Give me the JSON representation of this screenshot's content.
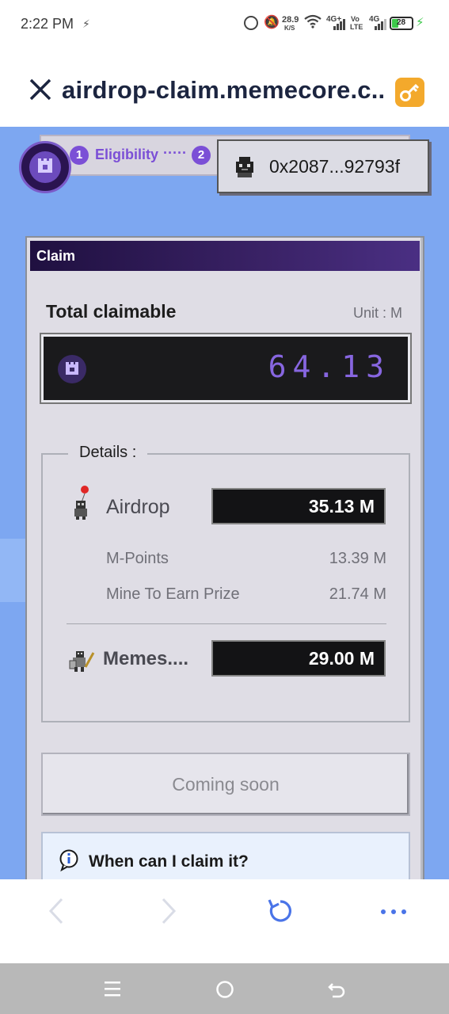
{
  "status": {
    "time": "2:22 PM",
    "speed_value": "28.9",
    "speed_unit": "K/S",
    "net1": "4G+",
    "volte_top": "Vo",
    "volte_bottom": "LTE",
    "net2": "4G",
    "battery": "28"
  },
  "browser": {
    "url": "airdrop-claim.memecore.c.."
  },
  "steps": {
    "step1_num": "1",
    "step1_label": "Eligibility",
    "dots": "·····",
    "step2_num": "2"
  },
  "wallet": {
    "address": "0x2087...92793f"
  },
  "claim": {
    "title": "Claim",
    "total_label": "Total claimable",
    "unit_label": "Unit : M",
    "total_value": "64.13",
    "details_legend": "Details :",
    "airdrop_label": "Airdrop",
    "airdrop_value": "35.13  M",
    "mpoints_label": "M-Points",
    "mpoints_value": "13.39 M",
    "mine_label": "Mine To Earn Prize",
    "mine_value": "21.74 M",
    "memes_label": "Memes....",
    "memes_value": "29.00  M",
    "coming_soon": "Coming soon",
    "faq_question": "When can I claim it?"
  },
  "icons": {
    "close": "close-icon",
    "key": "key-icon",
    "wallet_avatar": "pixel-avatar-icon",
    "info": "info-icon",
    "back": "chevron-left-icon",
    "forward": "chevron-right-icon",
    "reload": "reload-icon",
    "more": "more-icon"
  },
  "colors": {
    "page_bg": "#7da7f1",
    "accent": "#7b4fd6",
    "key_btn": "#f3a92c",
    "card_title_bg": "#2b1858"
  }
}
